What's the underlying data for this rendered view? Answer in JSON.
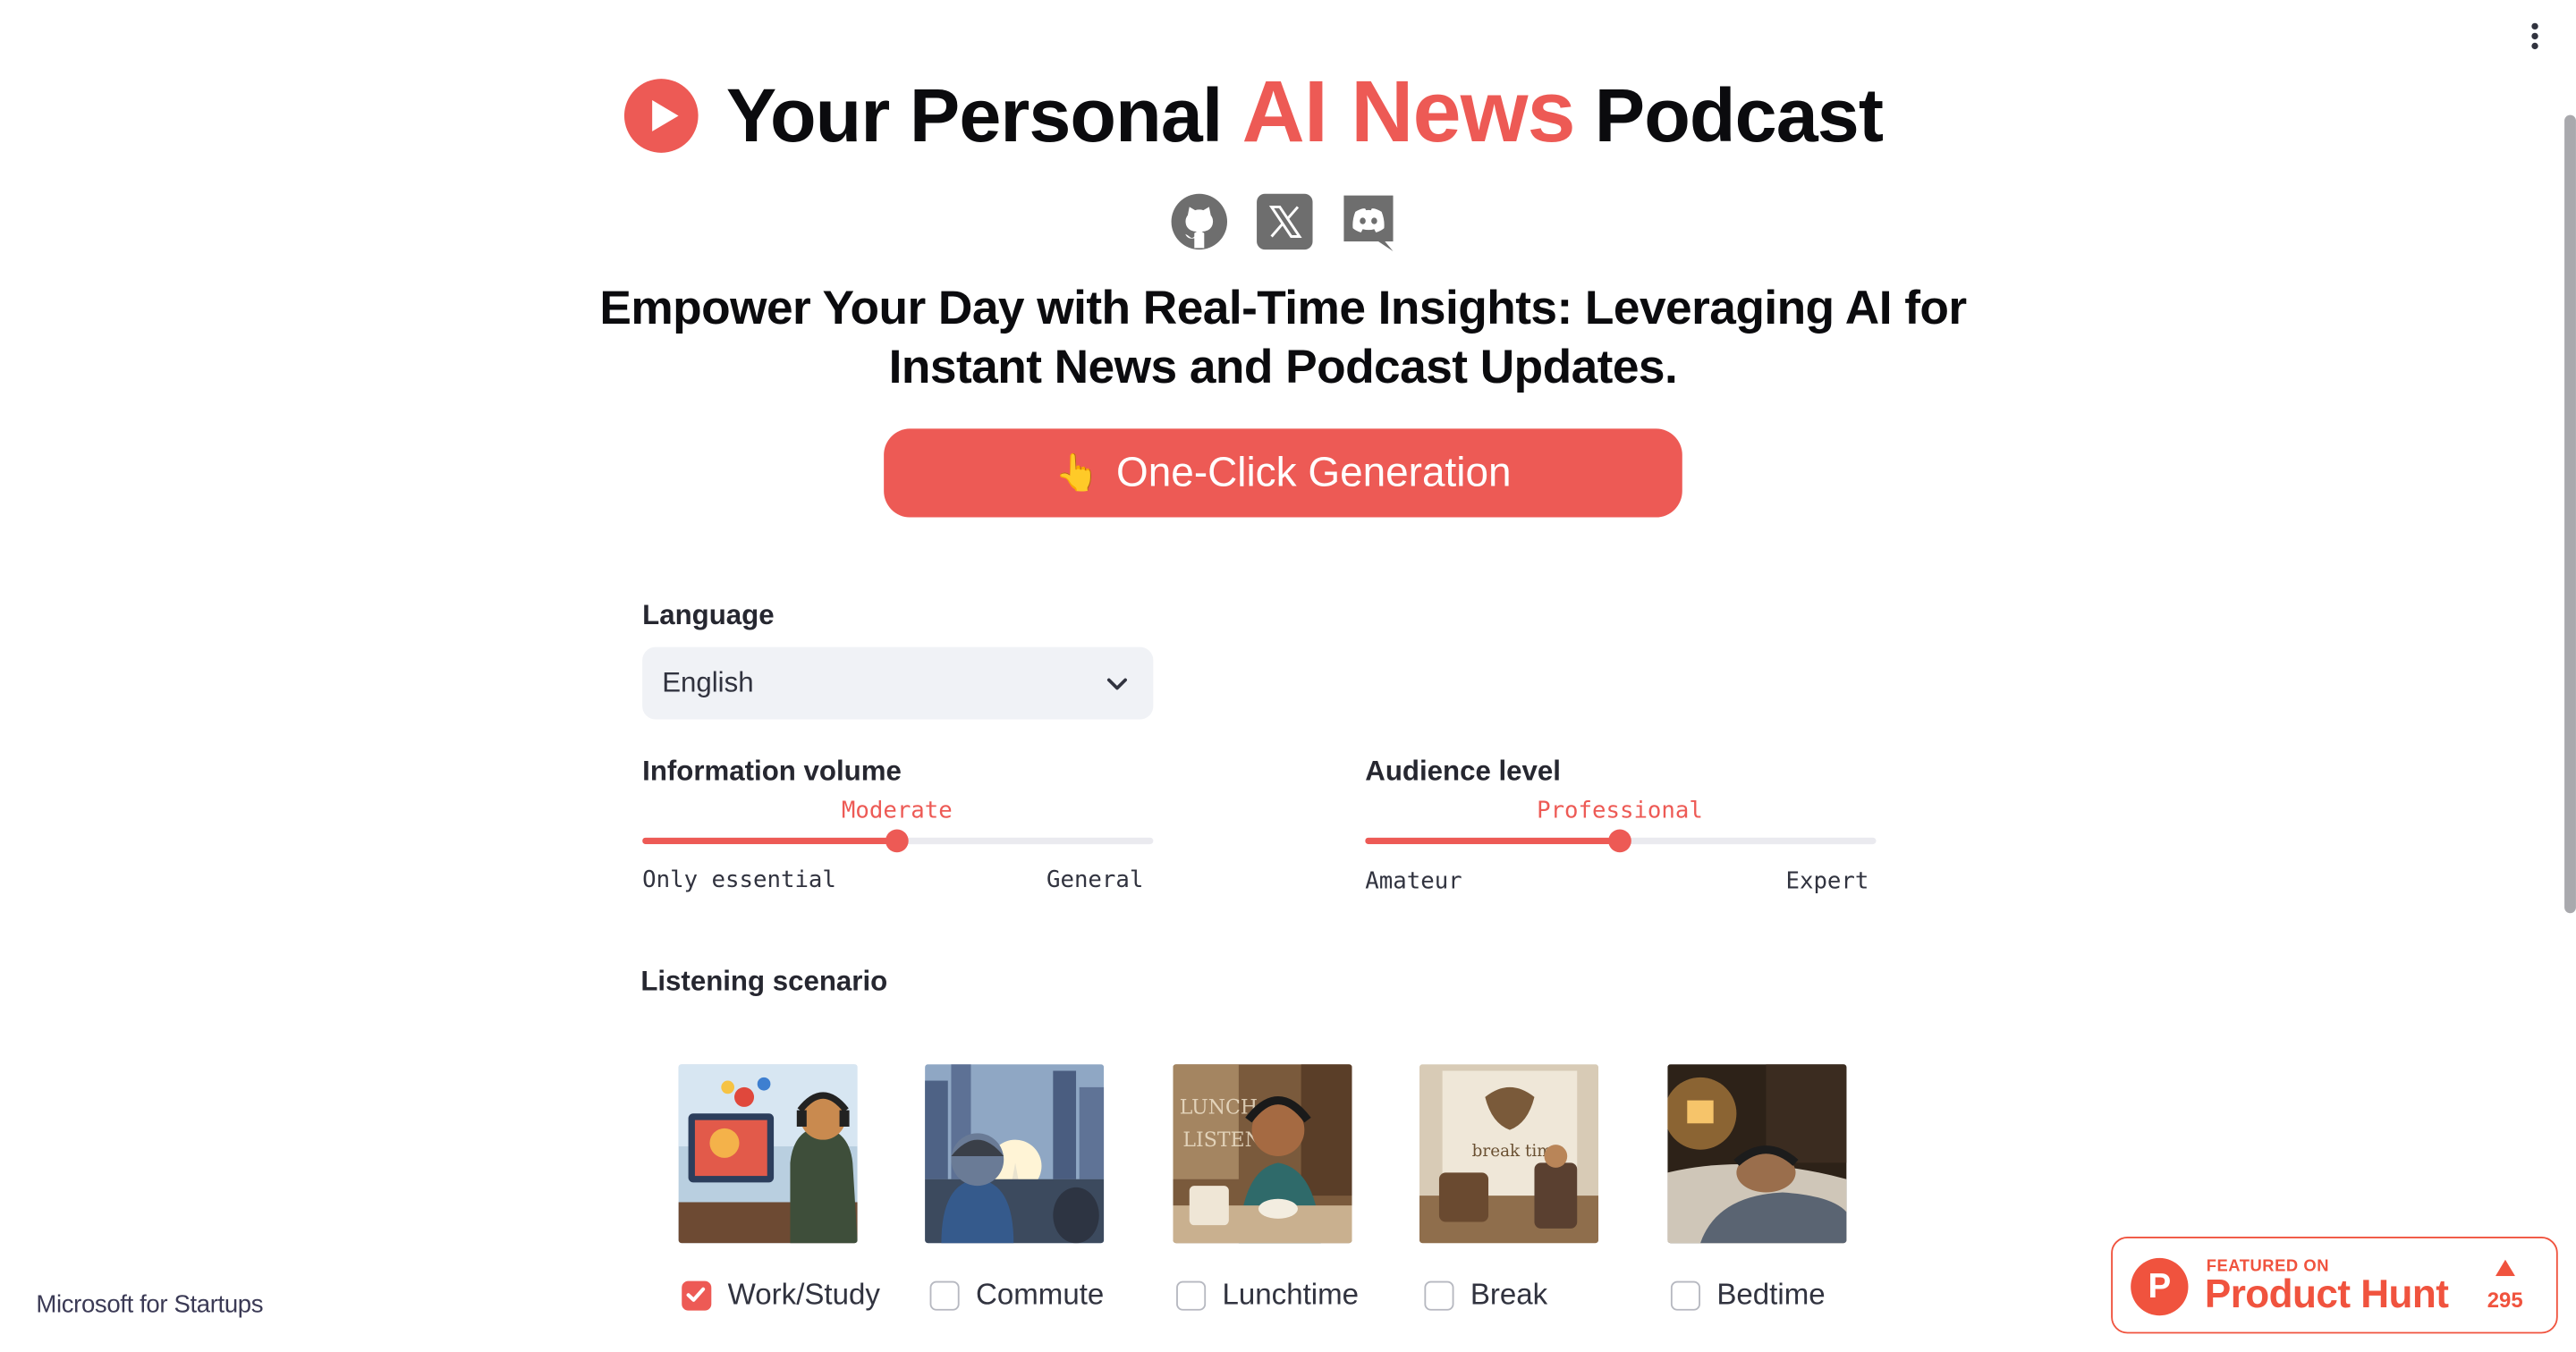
{
  "header": {
    "title_pre": "Your Personal",
    "title_accent": "AI News",
    "title_post": "Podcast",
    "accent_color": "#ed5a55"
  },
  "social": [
    {
      "icon": "github-icon"
    },
    {
      "icon": "x-twitter-icon"
    },
    {
      "icon": "discord-icon"
    }
  ],
  "subtitle": "Empower Your Day with Real-Time Insights: Leveraging AI for Instant News and Podcast Updates.",
  "generate_button": {
    "emoji": "👆",
    "label": "One-Click Generation"
  },
  "language": {
    "label": "Language",
    "value": "English"
  },
  "info_volume": {
    "label": "Information volume",
    "value": "Moderate",
    "min_label": "Only essential",
    "max_label": "General",
    "position": 0.5
  },
  "audience_level": {
    "label": "Audience level",
    "value": "Professional",
    "min_label": "Amateur",
    "max_label": "Expert",
    "position": 0.5
  },
  "scenario": {
    "label": "Listening scenario",
    "options": [
      {
        "label": "Work/Study",
        "checked": true
      },
      {
        "label": "Commute",
        "checked": false
      },
      {
        "label": "Lunchtime",
        "checked": false
      },
      {
        "label": "Break",
        "checked": false
      },
      {
        "label": "Bedtime",
        "checked": false
      }
    ]
  },
  "footer": {
    "sponsor": "Microsoft for Startups"
  },
  "product_hunt": {
    "featured": "FEATURED ON",
    "name": "Product Hunt",
    "count": "295"
  }
}
